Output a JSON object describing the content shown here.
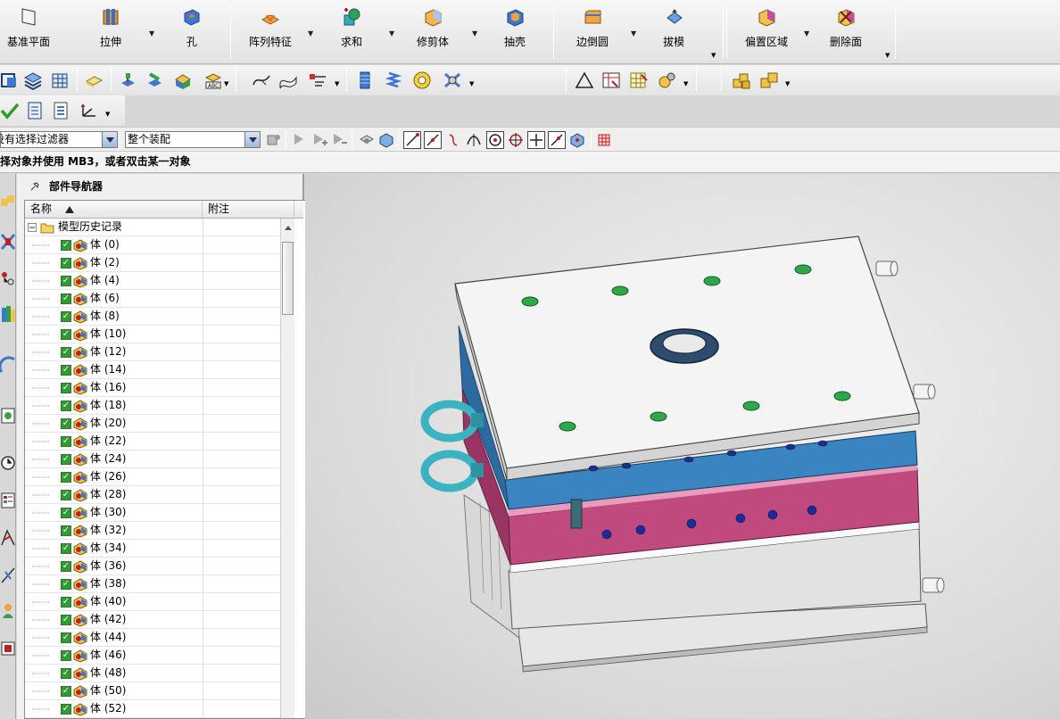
{
  "ribbon": {
    "buttons": [
      {
        "label": "基准平面",
        "icon": "datum-plane-icon"
      },
      {
        "label": "拉伸",
        "icon": "extrude-icon"
      },
      {
        "label": "孔",
        "icon": "hole-icon"
      },
      {
        "label": "阵列特征",
        "icon": "pattern-feature-icon"
      },
      {
        "label": "求和",
        "icon": "unite-icon"
      },
      {
        "label": "修剪体",
        "icon": "trim-body-icon"
      },
      {
        "label": "抽壳",
        "icon": "shell-icon"
      },
      {
        "label": "边倒圆",
        "icon": "edge-blend-icon"
      },
      {
        "label": "拔模",
        "icon": "draft-icon"
      },
      {
        "label": "偏置区域",
        "icon": "offset-region-icon"
      },
      {
        "label": "删除面",
        "icon": "delete-face-icon"
      }
    ]
  },
  "selection_bar": {
    "filter_value": "没有选择过滤器",
    "scope_value": "整个装配"
  },
  "cue_line": "择对象并使用 MB3，或者双击某一对象",
  "navigator": {
    "title": "部件导航器",
    "columns": [
      "名称",
      "附注"
    ],
    "root_label": "模型历史记录",
    "items": [
      "体 (0)",
      "体 (2)",
      "体 (4)",
      "体 (6)",
      "体 (8)",
      "体 (10)",
      "体 (12)",
      "体 (14)",
      "体 (16)",
      "体 (18)",
      "体 (20)",
      "体 (22)",
      "体 (24)",
      "体 (26)",
      "体 (28)",
      "体 (30)",
      "体 (32)",
      "体 (34)",
      "体 (36)",
      "体 (38)",
      "体 (40)",
      "体 (42)",
      "体 (44)",
      "体 (46)",
      "体 (48)",
      "体 (50)",
      "体 (52)"
    ]
  },
  "colors": {
    "accent_green": "#2e9c2e",
    "plate_top": "#f4f4f4",
    "plate_blue": "#3b84c2",
    "plate_pink": "#c0497e",
    "plate_grey": "#dedede",
    "hardware_cyan": "#3bb3c0"
  }
}
